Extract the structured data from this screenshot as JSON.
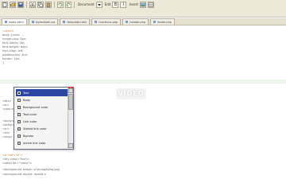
{
  "toolbar": {
    "buttons": [
      "new-icon",
      "open-icon",
      "save-icon",
      "cut-icon",
      "copy-icon",
      "paste-icon",
      "undo-icon",
      "redo-icon"
    ],
    "menu_a": "Document",
    "menu_b": "Edit",
    "menu_c": "Insert"
  },
  "tabs": [
    {
      "label": "index.html"
    },
    {
      "label": "stylesheet.css"
    },
    {
      "label": "template.html"
    },
    {
      "label": "functions.php"
    },
    {
      "label": "header.php"
    },
    {
      "label": "footer.php"
    }
  ],
  "editor": {
    "lines_top": [
      "<style>",
      "  body {color: ...",
      "  margin-top: 0px;",
      "  font-family: Ver...",
      "  font-weight: bold;",
      "  text-align: left;",
      "  padding-top: 4px;",
      "  border: 1px;",
      "}"
    ],
    "lines_bottom": [
      "<div>",
      "  <p>",
      "  <span>",
      "<body>",
      "  <table>",
      "  <tr>",
      "  <td>",
      "  <img>",
      "  <a href=\"#\">",
      "  <div class=\"foo\">",
      "  <label for=\"name\">",
      "  <background-image: url(images/bg.jpg)",
      "  <background-repeat: repeat-x"
    ]
  },
  "popup": {
    "items": [
      {
        "label": "Text"
      },
      {
        "label": "Body"
      },
      {
        "label": "Background color"
      },
      {
        "label": "Text color"
      },
      {
        "label": "Link color"
      },
      {
        "label": "Visited link color"
      },
      {
        "label": "Bgcolor"
      },
      {
        "label": "Active link color"
      }
    ],
    "selected_index": 0
  },
  "watermark": "VIDEO"
}
